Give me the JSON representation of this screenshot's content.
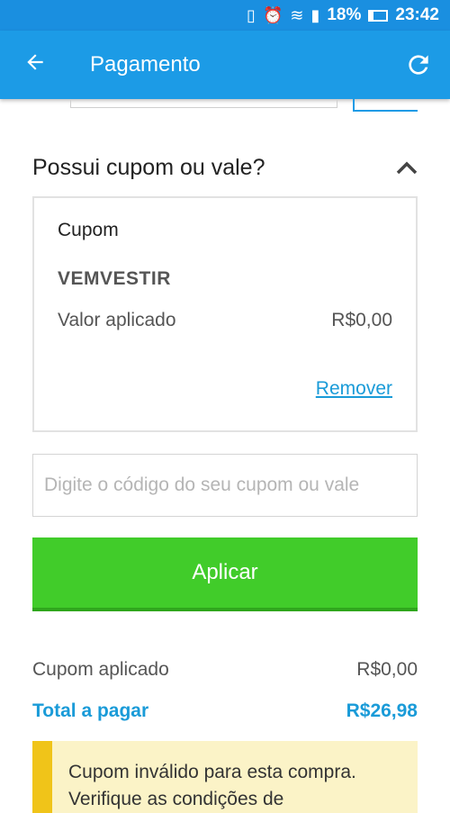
{
  "status_bar": {
    "battery_percent": "18%",
    "time": "23:42",
    "icons": [
      "vibrate-icon",
      "alarm-icon",
      "wifi-icon",
      "signal-icon",
      "battery-icon"
    ]
  },
  "app_bar": {
    "title": "Pagamento",
    "back_icon": "arrow-left-icon",
    "refresh_icon": "refresh-icon",
    "color": "#1c9be6"
  },
  "coupon_section": {
    "title": "Possui cupom ou vale?",
    "card": {
      "label": "Cupom",
      "code": "VEMVESTIR",
      "applied_label": "Valor aplicado",
      "applied_value": "R$0,00",
      "remove_label": "Remover"
    },
    "input": {
      "placeholder": "Digite o código do seu cupom ou vale",
      "value": ""
    },
    "apply_button": "Aplicar",
    "apply_color": "#41cc2a"
  },
  "summary": {
    "coupon_label": "Cupom aplicado",
    "coupon_value": "R$0,00",
    "total_label": "Total a pagar",
    "total_value": "R$26,98",
    "accent_color": "#1a9bd8"
  },
  "warning": {
    "message": "Cupom inválido para esta compra. Verifique as condições de"
  }
}
